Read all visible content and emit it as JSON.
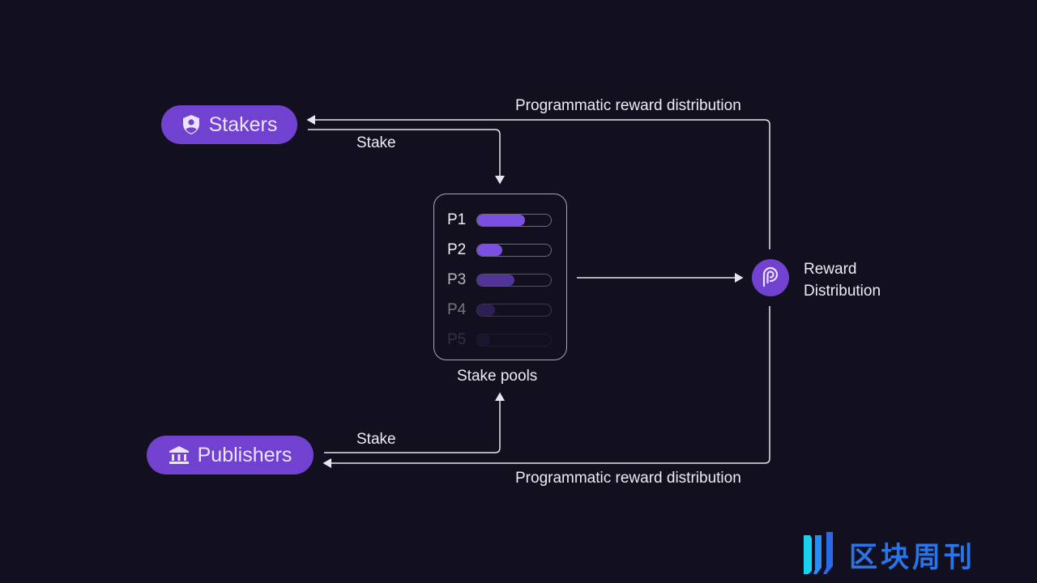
{
  "nodes": {
    "stakers": {
      "label": "Stakers",
      "icon": "shield-user-icon"
    },
    "publishers": {
      "label": "Publishers",
      "icon": "bank-icon"
    },
    "reward": {
      "line1": "Reward",
      "line2": "Distribution",
      "icon": "pyth-logo-icon"
    }
  },
  "edges": {
    "stake_top": "Stake",
    "stake_bottom": "Stake",
    "reward_top": "Programmatic reward distribution",
    "reward_bottom": "Programmatic reward distribution"
  },
  "stake_pools": {
    "title": "Stake pools",
    "pools": [
      {
        "name": "P1",
        "fill_pct": 65,
        "opacity": 1.0
      },
      {
        "name": "P2",
        "fill_pct": 34,
        "opacity": 1.0
      },
      {
        "name": "P3",
        "fill_pct": 50,
        "opacity": 0.75
      },
      {
        "name": "P4",
        "fill_pct": 24,
        "opacity": 0.45
      },
      {
        "name": "P5",
        "fill_pct": 18,
        "opacity": 0.15
      }
    ]
  },
  "colors": {
    "accent": "#7142cf",
    "background": "#12101f",
    "line": "#e6e6ee"
  },
  "watermark": {
    "text": "区块周刊"
  }
}
